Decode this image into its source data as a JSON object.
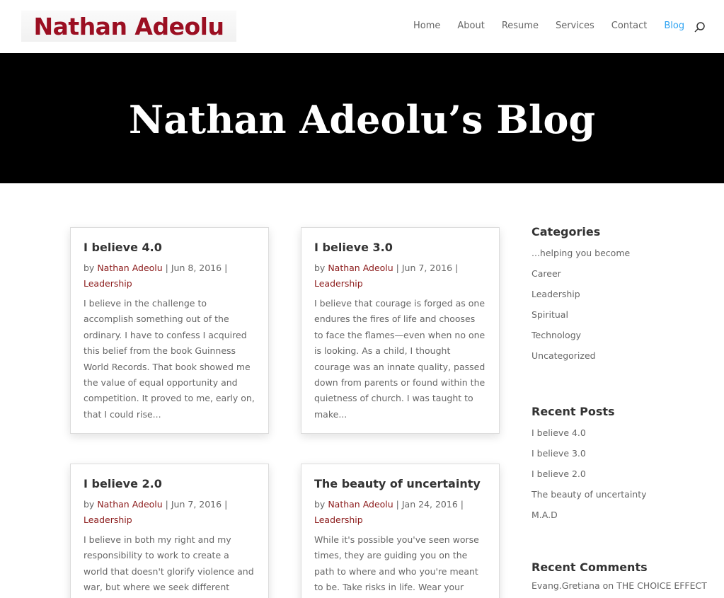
{
  "header": {
    "logo_text": "Nathan Adeolu",
    "nav": [
      {
        "label": "Home",
        "active": false
      },
      {
        "label": "About",
        "active": false
      },
      {
        "label": "Resume",
        "active": false
      },
      {
        "label": "Services",
        "active": false
      },
      {
        "label": "Contact",
        "active": false
      },
      {
        "label": "Blog",
        "active": true
      }
    ],
    "search_icon": "search-icon"
  },
  "hero": {
    "title": "Nathan Adeolu’s Blog"
  },
  "posts": [
    {
      "title": "I believe 4.0",
      "by": "by ",
      "author": "Nathan Adeolu",
      "sep1": " | ",
      "date": "Jun 8, 2016",
      "sep2": " |",
      "category": "Leadership",
      "excerpt": "I believe in the challenge to accomplish something out of the ordinary. I have to confess I acquired this belief from the book Guinness World Records. That book showed me the value of equal opportunity and competition. It proved to me, early on, that I could rise..."
    },
    {
      "title": "I believe 3.0",
      "by": "by ",
      "author": "Nathan Adeolu",
      "sep1": " | ",
      "date": "Jun 7, 2016",
      "sep2": " |",
      "category": "Leadership",
      "excerpt": "I believe that courage is forged as one endures the fires of life and chooses to face the flames—even when no one is looking. As a child, I thought courage was an innate quality, passed down from parents or found within the quietness of church. I was taught to make..."
    },
    {
      "title": "I believe 2.0",
      "by": "by ",
      "author": "Nathan Adeolu",
      "sep1": " | ",
      "date": "Jun 7, 2016",
      "sep2": " |",
      "category": "Leadership",
      "excerpt": "I believe in both my right and my responsibility to work to create a world that doesn't glorify violence and war, but where we seek different solutions"
    },
    {
      "title": "The beauty of uncertainty",
      "by": "by ",
      "author": "Nathan Adeolu",
      "sep1": " | ",
      "date": "Jan 24, 2016",
      "sep2": " |",
      "category": "Leadership",
      "excerpt": "While it's possible you've seen worse times, they are guiding you on the path to where and who you're meant to be. Take risks in life. Wear your heart on"
    }
  ],
  "sidebar": {
    "categories_title": "Categories",
    "categories": [
      "...helping you become",
      "Career",
      "Leadership",
      "Spiritual",
      "Technology",
      "Uncategorized"
    ],
    "recent_posts_title": "Recent Posts",
    "recent_posts": [
      "I believe 4.0",
      "I believe 3.0",
      "I believe 2.0",
      "The beauty of uncertainty",
      "M.A.D"
    ],
    "recent_comments_title": "Recent Comments",
    "comment_author": "Evang.Gretiana",
    "comment_on": " on ",
    "comment_post": "THE CHOICE EFFECT"
  },
  "colors": {
    "accent": "#2ea3f2",
    "brand": "#9b0f22",
    "link": "#8b1a1a"
  }
}
